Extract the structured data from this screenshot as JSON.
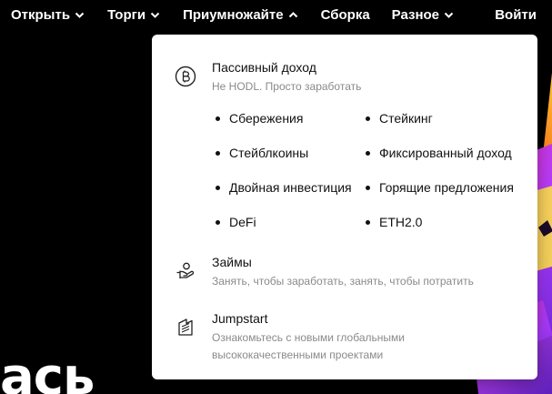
{
  "nav": {
    "items": [
      {
        "label": "Открыть",
        "has_chevron": true
      },
      {
        "label": "Торги",
        "has_chevron": true
      },
      {
        "label": "Приумножайте",
        "has_chevron": true,
        "open": true
      },
      {
        "label": "Сборка",
        "has_chevron": false
      },
      {
        "label": "Разное",
        "has_chevron": true
      }
    ],
    "login": "Войти"
  },
  "hero": {
    "partial_text": "ась"
  },
  "menu": {
    "passive": {
      "title": "Пассивный доход",
      "subtitle": "Не HODL. Просто заработать",
      "icon": "bitcoin-coin-icon",
      "items": [
        "Сбережения",
        "Стейкинг",
        "Стейблкоины",
        "Фиксированный доход",
        "Двойная инвестиция",
        "Горящие предложения",
        "DeFi",
        "ETH2.0"
      ]
    },
    "loans": {
      "title": "Займы",
      "subtitle": "Занять, чтобы заработать, занять, чтобы потратить",
      "icon": "hand-coin-icon"
    },
    "jumpstart": {
      "title": "Jumpstart",
      "subtitle_line1": "Ознакомьтесь с новыми глобальными",
      "subtitle_line2": "высококачественными проектами",
      "icon": "rocket-lines-icon"
    }
  },
  "colors": {
    "background": "#000000",
    "panel": "#ffffff",
    "subtext": "#8a8a8a"
  }
}
